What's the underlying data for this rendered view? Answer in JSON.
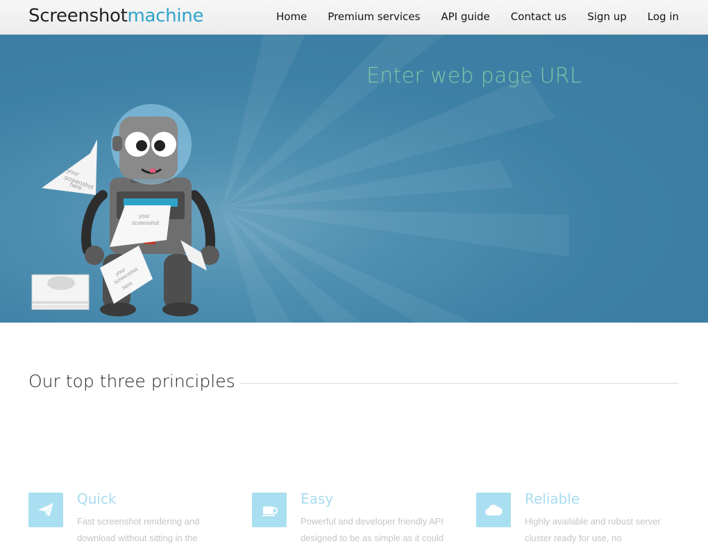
{
  "header": {
    "logo_main": "Screenshot",
    "logo_accent": "machine",
    "nav": [
      "Home",
      "Premium services",
      "API guide",
      "Contact us",
      "Sign up",
      "Log in"
    ]
  },
  "hero": {
    "heading": "Enter web page URL",
    "paper_text_line1": "your",
    "paper_text_line2": "screenshot",
    "paper_text_line3": "here"
  },
  "principles": {
    "title": "Our top three principles",
    "items": [
      {
        "name": "Quick",
        "icon": "paper-plane-icon",
        "line1": "Fast screenshot rendering and",
        "line2": "download without sitting in the"
      },
      {
        "name": "Easy",
        "icon": "coffee-cup-icon",
        "line1": "Powerful and developer friendly API",
        "line2": "designed to be as simple as it could"
      },
      {
        "name": "Reliable",
        "icon": "cloud-icon",
        "line1": "Highly available and robust server",
        "line2": "cluster ready for use, no"
      }
    ]
  },
  "colors": {
    "accent": "#2ea3c8",
    "hero_bg": "#3e81a6",
    "hero_heading": "#8fd0a6",
    "feature_icon_bg": "#a9dff0"
  }
}
